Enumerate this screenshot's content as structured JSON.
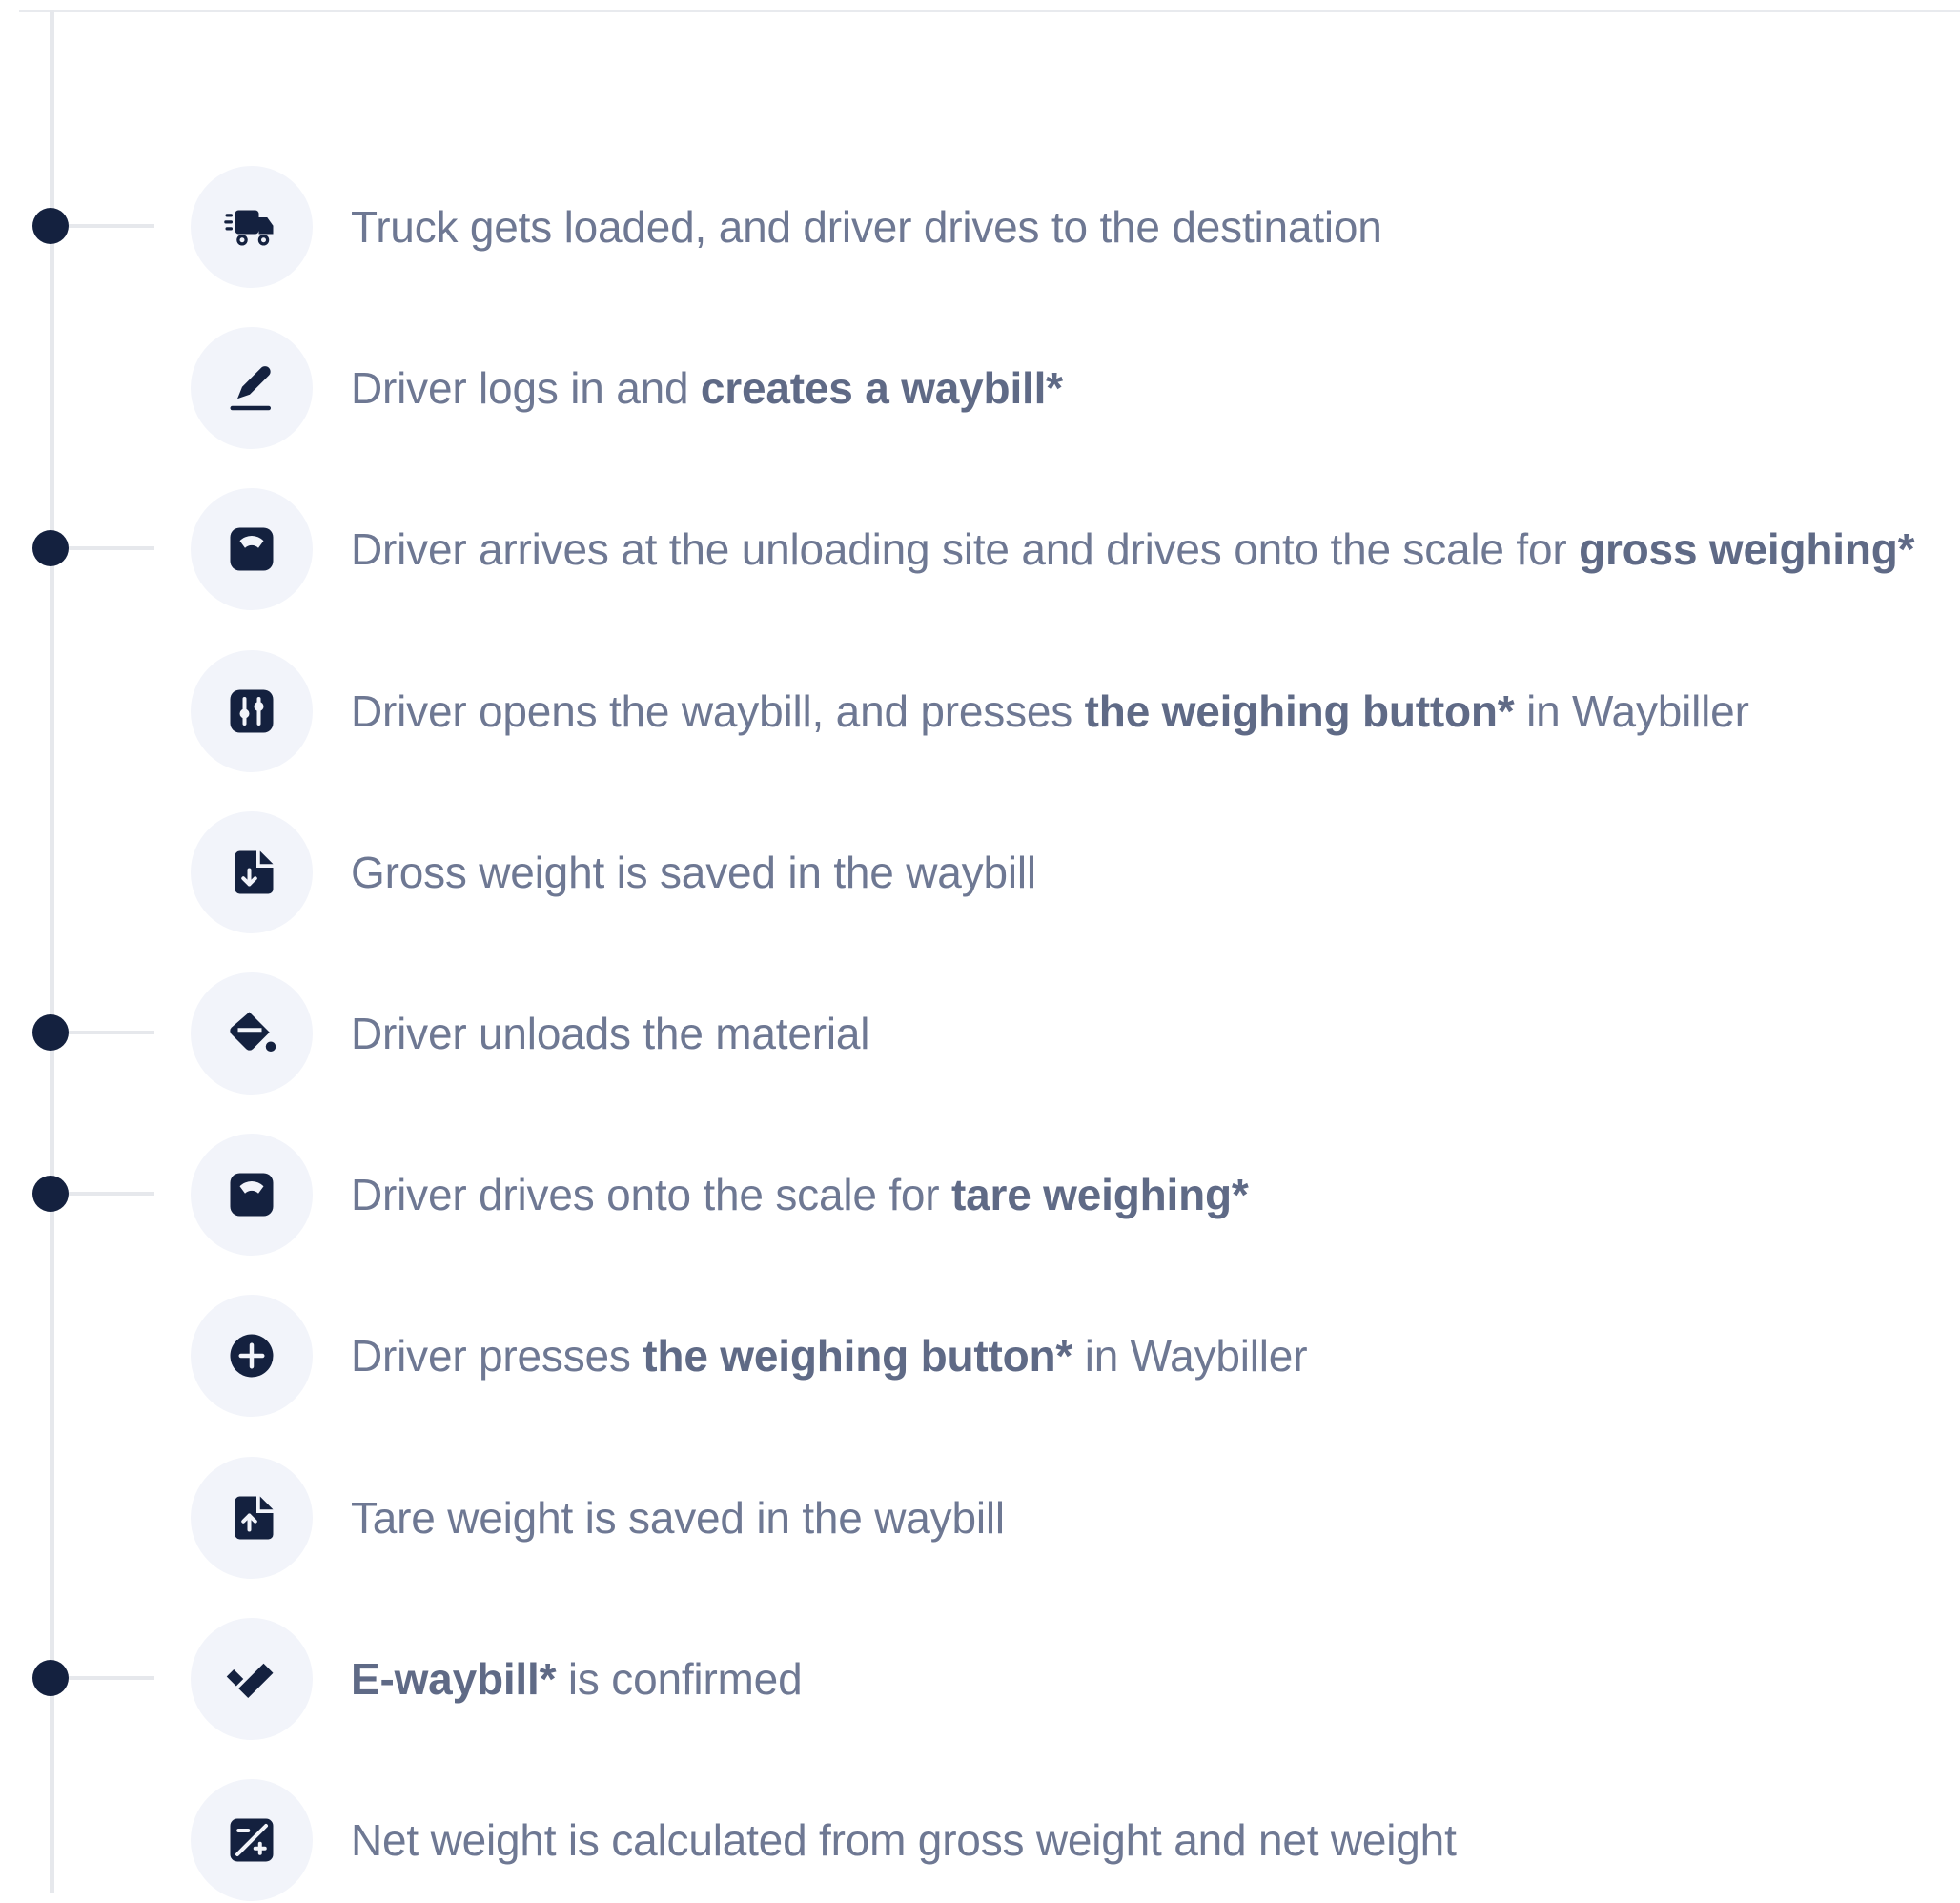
{
  "steps": [
    {
      "icon": "truck-icon",
      "milestone": true,
      "parts": [
        {
          "text": "Truck gets loaded, and driver drives to the destination",
          "bold": false
        }
      ]
    },
    {
      "icon": "sign-pen-icon",
      "milestone": false,
      "parts": [
        {
          "text": "Driver logs in and ",
          "bold": false
        },
        {
          "text": "creates a waybill*",
          "bold": true
        }
      ]
    },
    {
      "icon": "scale-icon",
      "milestone": true,
      "parts": [
        {
          "text": "Driver arrives at the unloading site and drives onto the scale for ",
          "bold": false
        },
        {
          "text": "gross weighing*",
          "bold": true
        }
      ]
    },
    {
      "icon": "sliders-icon",
      "milestone": false,
      "parts": [
        {
          "text": "Driver opens the waybill, and presses ",
          "bold": false
        },
        {
          "text": "the weighing button*",
          "bold": true
        },
        {
          "text": " in Waybiller",
          "bold": false
        }
      ]
    },
    {
      "icon": "file-download-icon",
      "milestone": false,
      "parts": [
        {
          "text": "Gross weight is saved in the waybill",
          "bold": false
        }
      ]
    },
    {
      "icon": "bucket-icon",
      "milestone": true,
      "parts": [
        {
          "text": "Driver unloads the material",
          "bold": false
        }
      ]
    },
    {
      "icon": "scale-icon",
      "milestone": true,
      "parts": [
        {
          "text": "Driver drives onto the scale for ",
          "bold": false
        },
        {
          "text": "tare weighing*",
          "bold": true
        }
      ]
    },
    {
      "icon": "plus-circle-icon",
      "milestone": false,
      "parts": [
        {
          "text": "Driver presses ",
          "bold": false
        },
        {
          "text": "the weighing button*",
          "bold": true
        },
        {
          "text": " in Waybiller",
          "bold": false
        }
      ]
    },
    {
      "icon": "file-upload-icon",
      "milestone": false,
      "parts": [
        {
          "text": "Tare weight is saved in the waybill",
          "bold": false
        }
      ]
    },
    {
      "icon": "checkmark-icon",
      "milestone": true,
      "parts": [
        {
          "text": "E-waybill*",
          "bold": true
        },
        {
          "text": " is confirmed",
          "bold": false
        }
      ]
    },
    {
      "icon": "calculator-icon",
      "milestone": false,
      "parts": [
        {
          "text": "Net weight is calculated from gross weight and net weight",
          "bold": false
        }
      ]
    }
  ],
  "colors": {
    "dot": "#14213f",
    "icon": "#14213f",
    "icon_bg": "#f2f4fa",
    "text": "#6e7893",
    "line": "#e6e8ec"
  }
}
